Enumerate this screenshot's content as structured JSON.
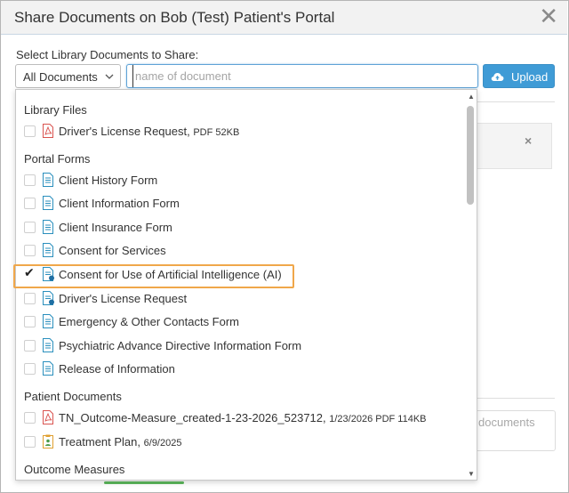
{
  "dialog": {
    "title": "Share Documents on Bob (Test) Patient's Portal",
    "close_glyph": "✕"
  },
  "toolbar": {
    "select_label": "Select Library Documents to Share:",
    "filter_value": "All Documents",
    "search_placeholder": "name of document",
    "search_value": "",
    "upload_label": "Upload"
  },
  "background": {
    "partial_text": "documents",
    "close_glyph": "×"
  },
  "library_files": {
    "header": "Library Files",
    "items": [
      {
        "label": "Driver's License Request,",
        "meta": "PDF 52KB",
        "icon": "pdf-icon",
        "checked": false
      }
    ]
  },
  "portal_forms": {
    "header": "Portal Forms",
    "items": [
      {
        "label": "Client History Form",
        "icon": "form-doc-icon",
        "checked": false
      },
      {
        "label": "Client Information Form",
        "icon": "form-doc-icon",
        "checked": false
      },
      {
        "label": "Client Insurance Form",
        "icon": "form-doc-icon",
        "checked": false
      },
      {
        "label": "Consent for Services",
        "icon": "form-doc-icon",
        "checked": false
      },
      {
        "label": "Consent for Use of Artificial Intelligence (AI)",
        "icon": "form-doc-signature-icon",
        "checked": true
      },
      {
        "label": "Driver's License Request",
        "icon": "form-doc-signature-icon",
        "checked": false
      },
      {
        "label": "Emergency & Other Contacts Form",
        "icon": "form-doc-icon",
        "checked": false
      },
      {
        "label": "Psychiatric Advance Directive Information Form",
        "icon": "form-doc-icon",
        "checked": false
      },
      {
        "label": "Release of Information",
        "icon": "form-doc-icon",
        "checked": false
      }
    ]
  },
  "patient_documents": {
    "header": "Patient Documents",
    "items": [
      {
        "label": "TN_Outcome-Measure_created-1-23-2026_523712,",
        "meta": "1/23/2026 PDF 114KB",
        "icon": "pdf-icon",
        "checked": false
      },
      {
        "label": "Treatment Plan,",
        "meta": "6/9/2025",
        "icon": "treatment-plan-icon",
        "checked": false
      }
    ]
  },
  "outcome_measures": {
    "header": "Outcome Measures"
  },
  "colors": {
    "accent": "#3f9bd6",
    "highlight": "#f0a74a",
    "pdf_red": "#d9534f",
    "form_teal": "#2a8fbd"
  }
}
